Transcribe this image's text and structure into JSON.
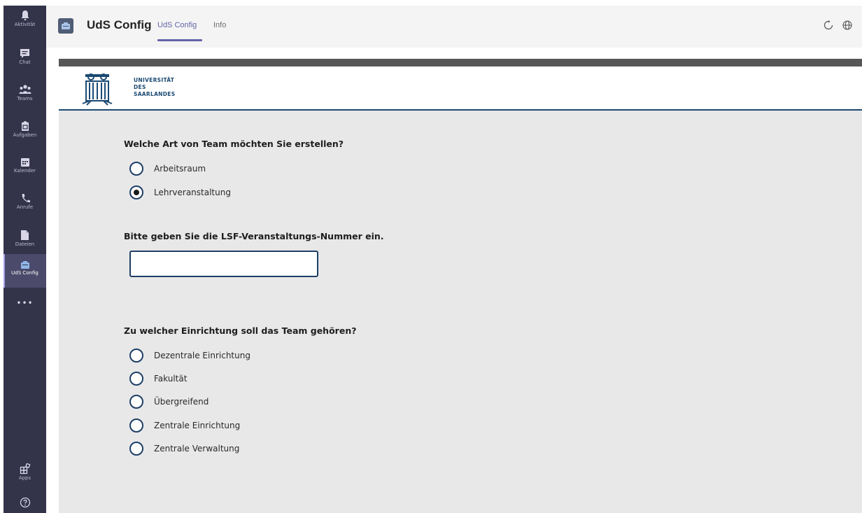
{
  "rail": {
    "items": [
      {
        "label": "Aktivität",
        "icon": "bell-icon"
      },
      {
        "label": "Chat",
        "icon": "chat-icon"
      },
      {
        "label": "Teams",
        "icon": "teams-icon"
      },
      {
        "label": "Aufgaben",
        "icon": "assignments-icon"
      },
      {
        "label": "Kalender",
        "icon": "calendar-icon"
      },
      {
        "label": "Anrufe",
        "icon": "phone-icon"
      },
      {
        "label": "Dateien",
        "icon": "file-icon"
      },
      {
        "label": "UdS Config",
        "icon": "uds-config-icon",
        "active": true
      }
    ],
    "more": "•••",
    "apps_label": "Apps",
    "help_icon": "help-icon"
  },
  "header": {
    "app_title": "UdS Config",
    "tabs": [
      {
        "label": "UdS Config",
        "active": true
      },
      {
        "label": "Info",
        "active": false
      }
    ],
    "accent_color": "#6264a7"
  },
  "logo": {
    "line1": "UNIVERSITÄT",
    "line2": "DES",
    "line3": "SAARLANDES",
    "brand_color": "#1c4a72"
  },
  "form": {
    "team_type": {
      "question": "Welche Art von Team möchten Sie erstellen?",
      "options": [
        {
          "label": "Arbeitsraum",
          "checked": false
        },
        {
          "label": "Lehrveranstaltung",
          "checked": true
        }
      ]
    },
    "lsf": {
      "question": "Bitte geben Sie die LSF-Veranstaltungs-Nummer ein.",
      "value": "",
      "placeholder": ""
    },
    "institution": {
      "question": "Zu welcher Einrichtung soll das Team gehören?",
      "options": [
        {
          "label": "Dezentrale Einrichtung",
          "checked": false
        },
        {
          "label": "Fakultät",
          "checked": false
        },
        {
          "label": "Übergreifend",
          "checked": false
        },
        {
          "label": "Zentrale Einrichtung",
          "checked": false
        },
        {
          "label": "Zentrale Verwaltung",
          "checked": false
        }
      ]
    }
  }
}
